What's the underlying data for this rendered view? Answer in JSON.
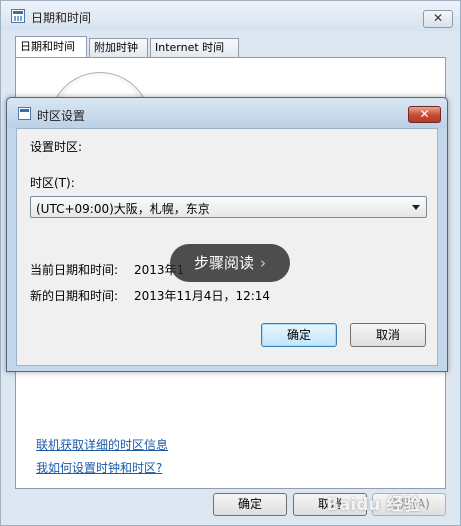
{
  "outer_window": {
    "title": "日期和时间",
    "close_glyph": "✕",
    "tabs": [
      {
        "label": "日期和时间"
      },
      {
        "label": "附加时钟"
      },
      {
        "label": "Internet 时间"
      }
    ],
    "links": [
      {
        "label": "联机获取详细的时区信息"
      },
      {
        "label": "我如何设置时钟和时区?"
      }
    ],
    "buttons": {
      "ok": "确定",
      "cancel": "取消",
      "apply": "应用(A)"
    }
  },
  "dialog": {
    "title": "时区设置",
    "close_glyph": "✕",
    "set_timezone_label": "设置时区:",
    "timezone_label": "时区(T):",
    "timezone_value": "(UTC+09:00)大阪，札幌，东京",
    "current_datetime_label": "当前日期和时间:",
    "current_datetime_value": "2013年1",
    "new_datetime_label": "新的日期和时间:",
    "new_datetime_value": "2013年11月4日，12:14",
    "buttons": {
      "ok": "确定",
      "cancel": "取消"
    }
  },
  "overlay": {
    "label": "步骤阅读",
    "chevron": "›"
  },
  "watermark": {
    "text": "Baidu 经验"
  },
  "colors": {
    "dialog_close_red": "#c74a33",
    "link_blue": "#1b5aa8",
    "overlay_bg": "#282828"
  }
}
